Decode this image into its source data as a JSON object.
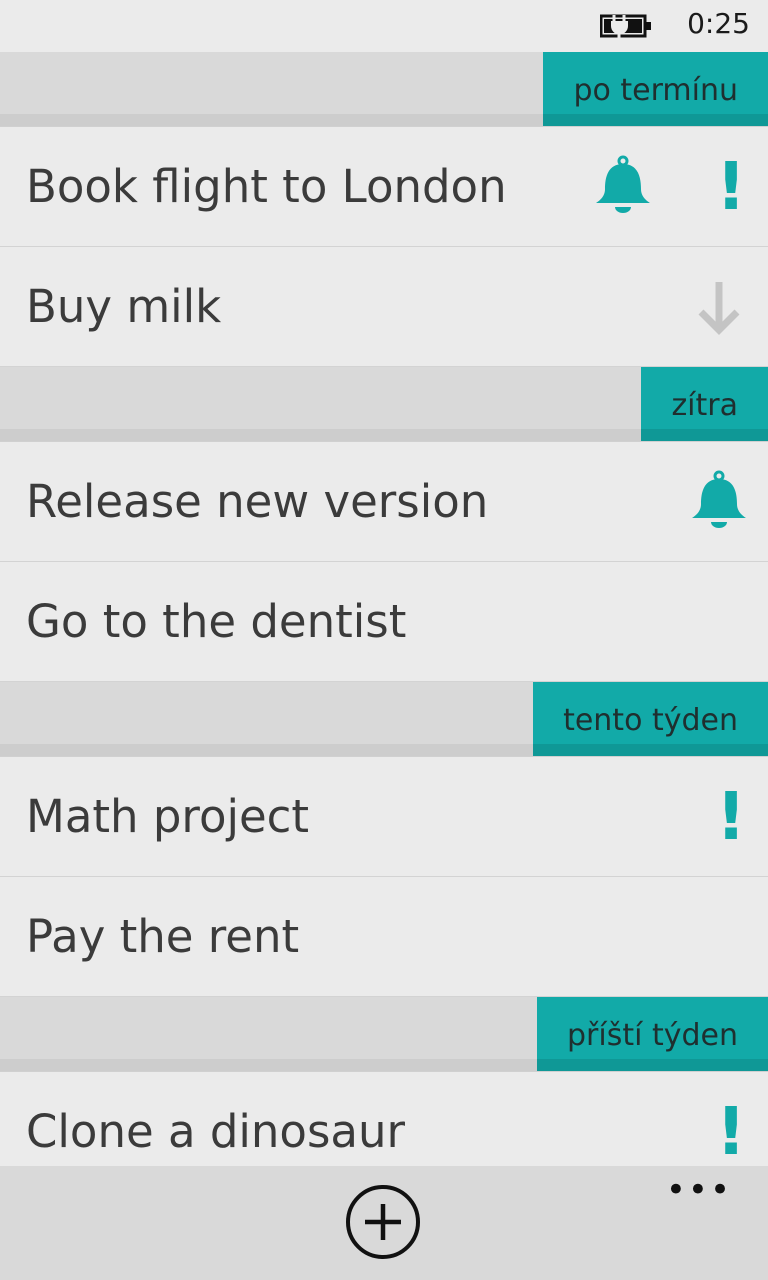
{
  "status_bar": {
    "time": "0:25",
    "battery_icon": "battery-charging-icon"
  },
  "accent_color": "#12aaa8",
  "groups": [
    {
      "label": "po termínu",
      "tasks": [
        {
          "title": "Book flight to London",
          "reminder": true,
          "priority": "high"
        },
        {
          "title": "Buy milk",
          "reminder": false,
          "priority": "low"
        }
      ]
    },
    {
      "label": "zítra",
      "tasks": [
        {
          "title": "Release new version",
          "reminder": true,
          "priority": "normal"
        },
        {
          "title": "Go to the dentist",
          "reminder": false,
          "priority": "normal"
        }
      ]
    },
    {
      "label": "tento týden",
      "tasks": [
        {
          "title": "Math project",
          "reminder": false,
          "priority": "high"
        },
        {
          "title": "Pay the rent",
          "reminder": false,
          "priority": "normal"
        }
      ]
    },
    {
      "label": "příští týden",
      "tasks": [
        {
          "title": "Clone a dinosaur",
          "reminder": false,
          "priority": "high"
        }
      ]
    }
  ],
  "app_bar": {
    "add_icon": "add-circle-icon",
    "more_label": "•••"
  }
}
